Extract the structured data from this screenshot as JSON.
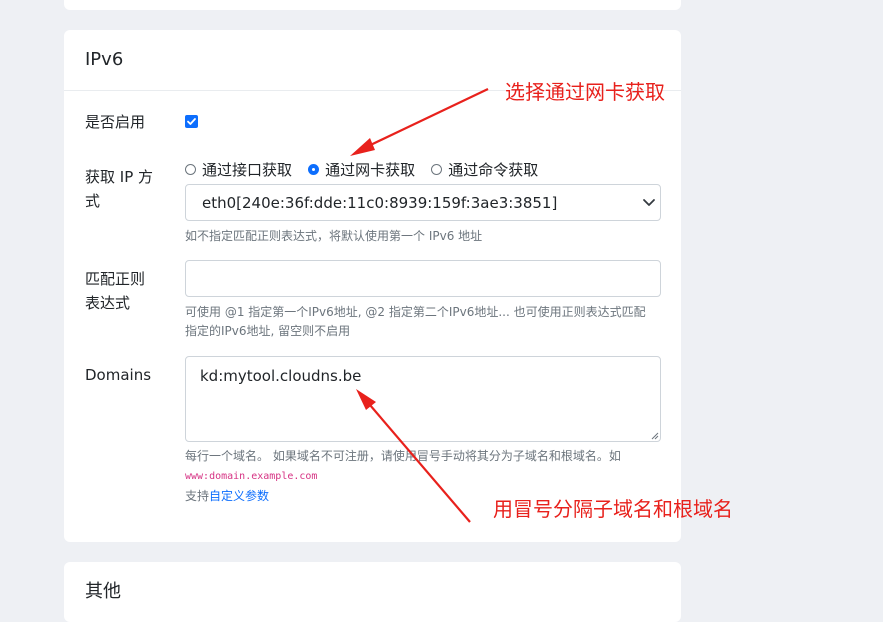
{
  "ipv6_section": {
    "title": "IPv6",
    "enable": {
      "label": "是否启用",
      "checked": true
    },
    "get_ip_method": {
      "label_line1": "获取 IP 方",
      "label_line2": "式",
      "options": [
        {
          "label": "通过接口获取",
          "selected": false
        },
        {
          "label": "通过网卡获取",
          "selected": true
        },
        {
          "label": "通过命令获取",
          "selected": false
        }
      ],
      "selected_interface": "eth0[240e:36f:dde:11c0:8939:159f:3ae3:3851]",
      "help": "如不指定匹配正则表达式，将默认使用第一个 IPv6 地址"
    },
    "regex": {
      "label_line1": "匹配正则",
      "label_line2": "表达式",
      "value": "",
      "help_line1": "可使用 @1 指定第一个IPv6地址, @2 指定第二个IPv6地址... 也可使用正则表达式匹配",
      "help_line2": "指定的IPv6地址, 留空则不启用"
    },
    "domains": {
      "label": "Domains",
      "value": "kd:mytool.cloudns.be",
      "help_line1": "每行一个域名。 如果域名不可注册，请使用冒号手动将其分为子域名和根域名。如",
      "example": "www:domain.example.com",
      "support_prefix": "支持",
      "support_link": "自定义参数"
    }
  },
  "other_section": {
    "title": "其他"
  },
  "annotations": {
    "network_card": "选择通过网卡获取",
    "colon_split": "用冒号分隔子域名和根域名",
    "color": "#e8211c"
  },
  "colors": {
    "accent": "#0d6efd",
    "background": "#eef0f4",
    "code": "#d63384"
  }
}
